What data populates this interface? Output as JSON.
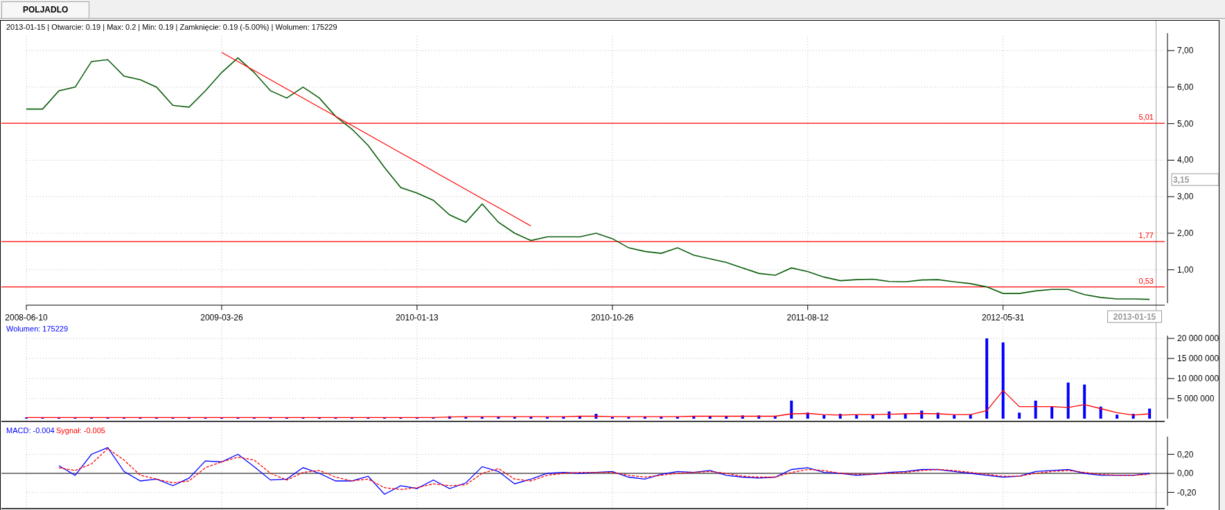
{
  "tabs": [
    {
      "label": "POLJADLO",
      "selected": true
    }
  ],
  "price_panel": {
    "info": "2013-01-15 | Otwarcie: 0.19 | Max: 0.2 | Min: 0.19 | Zamknięcie: 0.19 (-5.00%)  | Wolumen: 175229",
    "cursor_value": "3,15",
    "cursor_date": "2013-01-15",
    "chart_data": {
      "type": "line",
      "ylim": [
        0.03,
        7.4
      ],
      "categories": [
        "2008-06-10",
        null,
        null,
        null,
        null,
        null,
        null,
        null,
        null,
        null,
        null,
        null,
        "2009-03-26",
        null,
        null,
        null,
        null,
        null,
        null,
        null,
        null,
        null,
        null,
        null,
        "2010-01-13",
        null,
        null,
        null,
        null,
        null,
        null,
        null,
        null,
        null,
        null,
        null,
        "2010-10-26",
        null,
        null,
        null,
        null,
        null,
        null,
        null,
        null,
        null,
        null,
        null,
        "2011-08-12",
        null,
        null,
        null,
        null,
        null,
        null,
        null,
        null,
        null,
        null,
        null,
        "2012-05-31",
        null,
        null,
        null,
        null,
        null,
        null,
        null,
        null,
        null
      ],
      "yticks": [
        {
          "value": 7,
          "label": "7,00"
        },
        {
          "value": 6,
          "label": "6,00"
        },
        {
          "value": 5,
          "label": "5,00"
        },
        {
          "value": 4,
          "label": "4,00"
        },
        {
          "value": 3,
          "label": "3,00"
        },
        {
          "value": 2,
          "label": "2,00"
        },
        {
          "value": 1,
          "label": "1,00"
        }
      ],
      "series": [
        {
          "color": "#0b5d0b",
          "values": [
            5.4,
            5.4,
            5.9,
            6.0,
            6.7,
            6.75,
            6.3,
            6.2,
            6.0,
            5.5,
            5.45,
            5.9,
            6.4,
            6.8,
            6.4,
            5.9,
            5.7,
            6.0,
            5.7,
            5.2,
            4.85,
            4.4,
            3.8,
            3.25,
            3.1,
            2.9,
            2.5,
            2.3,
            2.8,
            2.3,
            2.0,
            1.8,
            1.9,
            1.9,
            1.9,
            2.0,
            1.85,
            1.6,
            1.5,
            1.45,
            1.6,
            1.4,
            1.3,
            1.2,
            1.05,
            0.9,
            0.85,
            1.05,
            0.95,
            0.8,
            0.7,
            0.73,
            0.74,
            0.68,
            0.67,
            0.72,
            0.73,
            0.67,
            0.62,
            0.53,
            0.35,
            0.35,
            0.42,
            0.46,
            0.46,
            0.32,
            0.24,
            0.2,
            0.2,
            0.19
          ]
        },
        {
          "color": "#ff0000",
          "values": [
            null,
            null,
            null,
            null,
            null,
            null,
            null,
            null,
            null,
            null,
            null,
            null,
            6.95,
            6.7,
            6.45,
            6.2,
            5.95,
            5.7,
            5.45,
            5.2,
            4.95,
            4.7,
            4.45,
            4.2,
            3.95,
            3.7,
            3.45,
            3.2,
            2.95,
            2.7,
            2.45,
            2.2,
            null,
            null,
            null,
            null,
            null,
            null,
            null,
            null,
            null,
            null,
            null,
            null,
            null,
            null,
            null,
            null,
            null,
            null,
            null,
            null,
            null,
            null,
            null,
            null,
            null,
            null,
            null,
            null,
            null,
            null,
            null,
            null,
            null,
            null,
            null,
            null,
            null,
            null
          ]
        }
      ],
      "grid": true,
      "ref_lines": [
        {
          "axis": "y",
          "value": 5.01,
          "label": "5,01"
        },
        {
          "axis": "y",
          "value": 1.77,
          "label": "1,77"
        },
        {
          "axis": "y",
          "value": 0.53,
          "label": "0,53"
        }
      ]
    }
  },
  "volume_panel": {
    "chart_data": {
      "type": "bar",
      "grid": true,
      "ylim": [
        0,
        20690000
      ],
      "categories": [
        null,
        null,
        null,
        null,
        null,
        null,
        null,
        null,
        null,
        null,
        null,
        null,
        null,
        null,
        null,
        null,
        null,
        null,
        null,
        null,
        null,
        null,
        null,
        null,
        null,
        null,
        null,
        null,
        null,
        null,
        null,
        null,
        null,
        null,
        null,
        null,
        null,
        null,
        null,
        null,
        null,
        null,
        null,
        null,
        null,
        null,
        null,
        null,
        null,
        null,
        null,
        null,
        null,
        null,
        null,
        null,
        null,
        null,
        null,
        null,
        null,
        null,
        null,
        null,
        null,
        null,
        null,
        null,
        null,
        null
      ],
      "yticks": [
        {
          "value": 20000000,
          "label": "20 000 000"
        },
        {
          "value": 15000000,
          "label": "15 000 000"
        },
        {
          "value": 10000000,
          "label": "10 000 000"
        },
        {
          "value": 5000000,
          "label": "5 000 000"
        }
      ],
      "series": [
        {
          "name": "Wolumen: 175229",
          "color": "#0000ff",
          "values": [
            300000,
            300000,
            300000,
            300000,
            300000,
            300000,
            300000,
            300000,
            300000,
            300000,
            300000,
            300000,
            300000,
            300000,
            300000,
            300000,
            300000,
            300000,
            300000,
            300000,
            300000,
            300000,
            300000,
            300000,
            300000,
            300000,
            600000,
            400000,
            400000,
            500000,
            400000,
            500000,
            400000,
            500000,
            600000,
            1200000,
            400000,
            400000,
            500000,
            500000,
            500000,
            600000,
            600000,
            700000,
            800000,
            800000,
            700000,
            4500000,
            1500000,
            900000,
            1200000,
            1000000,
            1000000,
            1800000,
            1300000,
            2000000,
            1500000,
            900000,
            1000000,
            20000000,
            19000000,
            1500000,
            4500000,
            3000000,
            9000000,
            8500000,
            3000000,
            1000000,
            1200000,
            2500000
          ]
        },
        {
          "type": "line",
          "color": "#ff0000",
          "values": [
            300000,
            300000,
            300000,
            300000,
            300000,
            300000,
            300000,
            300000,
            300000,
            300000,
            300000,
            300000,
            300000,
            300000,
            300000,
            300000,
            300000,
            300000,
            300000,
            300000,
            300000,
            300000,
            300000,
            300000,
            300000,
            300000,
            400000,
            500000,
            500000,
            500000,
            500000,
            500000,
            500000,
            500000,
            600000,
            600000,
            500000,
            500000,
            500000,
            500000,
            500000,
            600000,
            600000,
            600000,
            600000,
            600000,
            600000,
            1200000,
            1300000,
            1000000,
            900000,
            1000000,
            1000000,
            1100000,
            1200000,
            1300000,
            1200000,
            1000000,
            1000000,
            2000000,
            7000000,
            3000000,
            3000000,
            3000000,
            2800000,
            3500000,
            2500000,
            1500000,
            900000,
            1200000
          ]
        }
      ]
    }
  },
  "macd_panel": {
    "chart_data": {
      "type": "line",
      "grid": true,
      "ylim": [
        -0.356,
        0.371
      ],
      "categories": [
        null,
        null,
        null,
        null,
        null,
        null,
        null,
        null,
        null,
        null,
        null,
        null,
        null,
        null,
        null,
        null,
        null,
        null,
        null,
        null,
        null,
        null,
        null,
        null,
        null,
        null,
        null,
        null,
        null,
        null,
        null,
        null,
        null,
        null,
        null,
        null,
        null,
        null,
        null,
        null,
        null,
        null,
        null,
        null,
        null,
        null,
        null,
        null,
        null,
        null,
        null,
        null,
        null,
        null,
        null,
        null,
        null,
        null,
        null,
        null,
        null,
        null,
        null,
        null,
        null,
        null,
        null,
        null,
        null,
        null
      ],
      "yticks": [
        {
          "value": 0.2,
          "label": "0,20"
        },
        {
          "value": 0,
          "label": "0,00"
        },
        {
          "value": -0.2,
          "label": "-0,20"
        }
      ],
      "series": [
        {
          "name": "MACD: -0.004",
          "color": "#0000ff",
          "line_style": "solid",
          "values": [
            null,
            null,
            0.08,
            -0.02,
            0.2,
            0.27,
            0.02,
            -0.08,
            -0.06,
            -0.13,
            -0.05,
            0.13,
            0.12,
            0.2,
            0.07,
            -0.07,
            -0.06,
            0.06,
            0.0,
            -0.08,
            -0.08,
            -0.03,
            -0.22,
            -0.13,
            -0.16,
            -0.07,
            -0.16,
            -0.1,
            0.07,
            0.02,
            -0.11,
            -0.06,
            0.0,
            0.01,
            0.0,
            0.01,
            0.02,
            -0.04,
            -0.06,
            -0.01,
            0.02,
            0.01,
            0.03,
            -0.02,
            -0.04,
            -0.05,
            -0.04,
            0.04,
            0.06,
            0.01,
            0.0,
            -0.02,
            -0.01,
            0.01,
            0.02,
            0.04,
            0.04,
            0.02,
            0.0,
            -0.02,
            -0.04,
            -0.03,
            0.02,
            0.03,
            0.04,
            0.0,
            -0.02,
            -0.02,
            -0.02,
            0.0
          ]
        },
        {
          "name": "Sygnał: -0.005",
          "color": "#ff0000",
          "line_style": "dashed",
          "values": [
            null,
            null,
            0.06,
            0.03,
            0.1,
            0.26,
            0.14,
            -0.02,
            -0.06,
            -0.1,
            -0.08,
            0.06,
            0.12,
            0.17,
            0.14,
            0.0,
            -0.07,
            0.01,
            0.03,
            -0.04,
            -0.08,
            -0.06,
            -0.15,
            -0.17,
            -0.15,
            -0.11,
            -0.13,
            -0.12,
            0.0,
            0.05,
            -0.06,
            -0.08,
            -0.02,
            0.0,
            0.01,
            0.01,
            0.01,
            -0.02,
            -0.04,
            -0.02,
            0.0,
            0.01,
            0.02,
            0.0,
            -0.03,
            -0.04,
            -0.04,
            0.01,
            0.04,
            0.03,
            0.0,
            -0.01,
            -0.01,
            0.0,
            0.01,
            0.03,
            0.04,
            0.03,
            0.01,
            -0.01,
            -0.03,
            -0.03,
            0.0,
            0.02,
            0.03,
            0.01,
            -0.01,
            -0.02,
            -0.02,
            -0.01
          ]
        }
      ],
      "ref_lines": [
        {
          "axis": "y",
          "value": 0
        }
      ]
    }
  }
}
